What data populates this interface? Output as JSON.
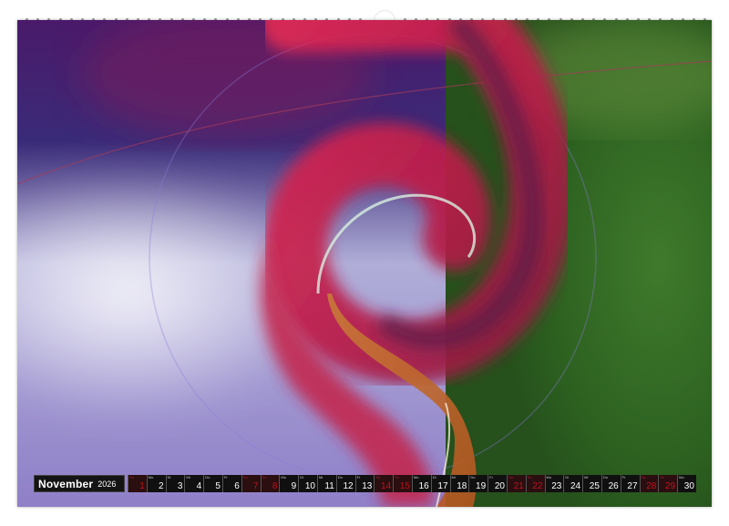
{
  "calendar": {
    "month": "November",
    "year": "2026",
    "days": [
      {
        "num": "1",
        "dow": "So",
        "weekend": true
      },
      {
        "num": "2",
        "dow": "Mo",
        "weekend": false
      },
      {
        "num": "3",
        "dow": "Di",
        "weekend": false
      },
      {
        "num": "4",
        "dow": "Mi",
        "weekend": false
      },
      {
        "num": "5",
        "dow": "Do",
        "weekend": false
      },
      {
        "num": "6",
        "dow": "Fr",
        "weekend": false
      },
      {
        "num": "7",
        "dow": "Sa",
        "weekend": true
      },
      {
        "num": "8",
        "dow": "So",
        "weekend": true
      },
      {
        "num": "9",
        "dow": "Mo",
        "weekend": false
      },
      {
        "num": "10",
        "dow": "Di",
        "weekend": false
      },
      {
        "num": "11",
        "dow": "Mi",
        "weekend": false
      },
      {
        "num": "12",
        "dow": "Do",
        "weekend": false
      },
      {
        "num": "13",
        "dow": "Fr",
        "weekend": false
      },
      {
        "num": "14",
        "dow": "Sa",
        "weekend": true
      },
      {
        "num": "15",
        "dow": "So",
        "weekend": true
      },
      {
        "num": "16",
        "dow": "Mo",
        "weekend": false
      },
      {
        "num": "17",
        "dow": "Di",
        "weekend": false
      },
      {
        "num": "18",
        "dow": "Mi",
        "weekend": false
      },
      {
        "num": "19",
        "dow": "Do",
        "weekend": false
      },
      {
        "num": "20",
        "dow": "Fr",
        "weekend": false
      },
      {
        "num": "21",
        "dow": "Sa",
        "weekend": true
      },
      {
        "num": "22",
        "dow": "So",
        "weekend": true
      },
      {
        "num": "23",
        "dow": "Mo",
        "weekend": false
      },
      {
        "num": "24",
        "dow": "Di",
        "weekend": false
      },
      {
        "num": "25",
        "dow": "Mi",
        "weekend": false
      },
      {
        "num": "26",
        "dow": "Do",
        "weekend": false
      },
      {
        "num": "27",
        "dow": "Fr",
        "weekend": false
      },
      {
        "num": "28",
        "dow": "Sa",
        "weekend": true
      },
      {
        "num": "29",
        "dow": "So",
        "weekend": true
      },
      {
        "num": "30",
        "dow": "Mo",
        "weekend": false
      }
    ]
  },
  "colors": {
    "background": "#ffffff",
    "purple": "#3a2a78",
    "lavender": "#c8c4e8",
    "red": "#d0254e",
    "green": "#2f6a22",
    "orange": "#c86a2a",
    "weekend_red": "#c0141c"
  }
}
